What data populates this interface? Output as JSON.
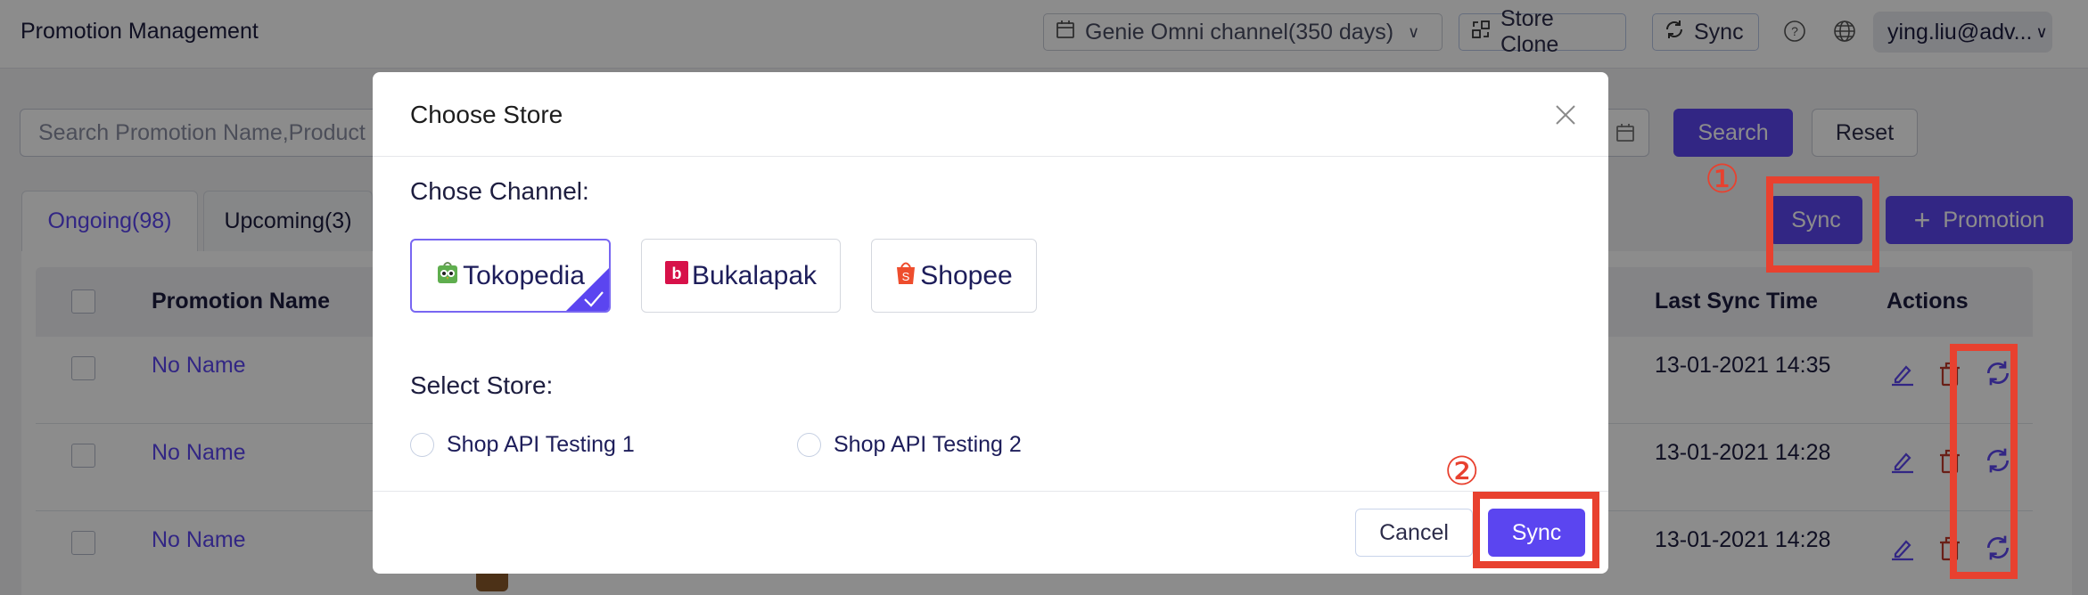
{
  "header": {
    "title": "Promotion Management",
    "store_selector": "Genie Omni channel(350 days)",
    "store_clone": "Store Clone",
    "sync": "Sync",
    "user": "ying.liu@adv..."
  },
  "filters": {
    "search_placeholder": "Search Promotion Name,Product",
    "search_button": "Search",
    "reset_button": "Reset"
  },
  "actions": {
    "sync_button": "Sync",
    "promotion_button": "Promotion"
  },
  "tabs": [
    {
      "label": "Ongoing(98)",
      "active": true
    },
    {
      "label": "Upcoming(3)",
      "active": false
    }
  ],
  "table": {
    "columns": [
      "Promotion Name",
      "Last Sync Time",
      "Actions"
    ],
    "rows": [
      {
        "name": "No Name",
        "last_sync": "13-01-2021 14:35"
      },
      {
        "name": "No Name",
        "last_sync": "13-01-2021 14:28"
      },
      {
        "name": "No Name",
        "last_sync": "13-01-2021 14:28"
      }
    ]
  },
  "annotations": {
    "step1": "①",
    "step2": "②",
    "color": "#e8412f"
  },
  "modal": {
    "title": "Choose Store",
    "channel_label": "Chose Channel:",
    "channels": [
      {
        "name": "Tokopedia",
        "selected": true
      },
      {
        "name": "Bukalapak",
        "selected": false
      },
      {
        "name": "Shopee",
        "selected": false
      }
    ],
    "store_label": "Select Store:",
    "stores": [
      {
        "name": "Shop API Testing 1",
        "selected": false
      },
      {
        "name": "Shop API Testing 2",
        "selected": false
      }
    ],
    "cancel": "Cancel",
    "confirm": "Sync"
  },
  "colors": {
    "primary": "#5b45f0",
    "danger": "#c0392b",
    "annotation": "#e8412f"
  }
}
